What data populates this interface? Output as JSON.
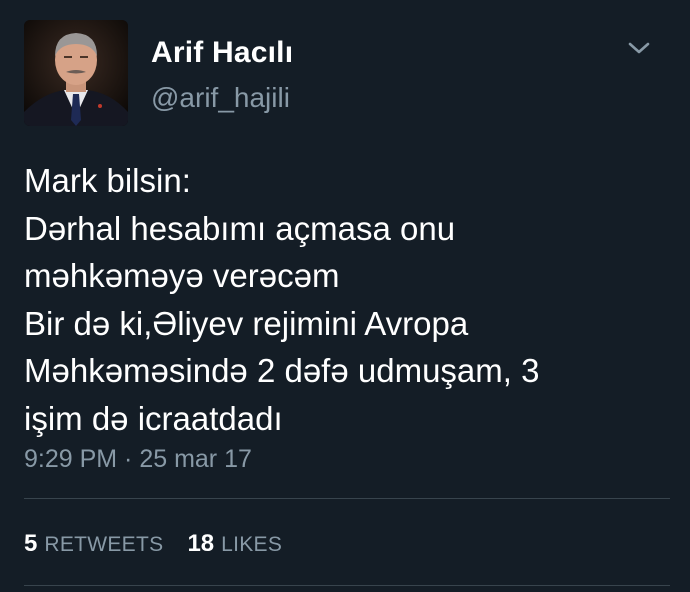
{
  "tweet": {
    "author": {
      "display_name": "Arif Hacılı",
      "handle": "@arif_hajili",
      "avatar_icon": "profile-photo"
    },
    "menu_icon": "chevron-down-icon",
    "text_lines": [
      "Mark bilsin:",
      "Dərhal hesabımı açmasa onu",
      "məhkəməyə verəcəm",
      "Bir də ki,Əliyev rejimini Avropa",
      "Məhkəməsində 2 dəfə udmuşam, 3",
      "işim də icraatdadı"
    ],
    "timestamp": "9:29 PM · 25 mar 17",
    "stats": {
      "retweets_count": "5",
      "retweets_label": "RETWEETS",
      "likes_count": "18",
      "likes_label": "LIKES"
    }
  },
  "colors": {
    "background": "#141d26",
    "primary_text": "#ffffff",
    "secondary_text": "#8899a6",
    "divider": "#38444d"
  }
}
